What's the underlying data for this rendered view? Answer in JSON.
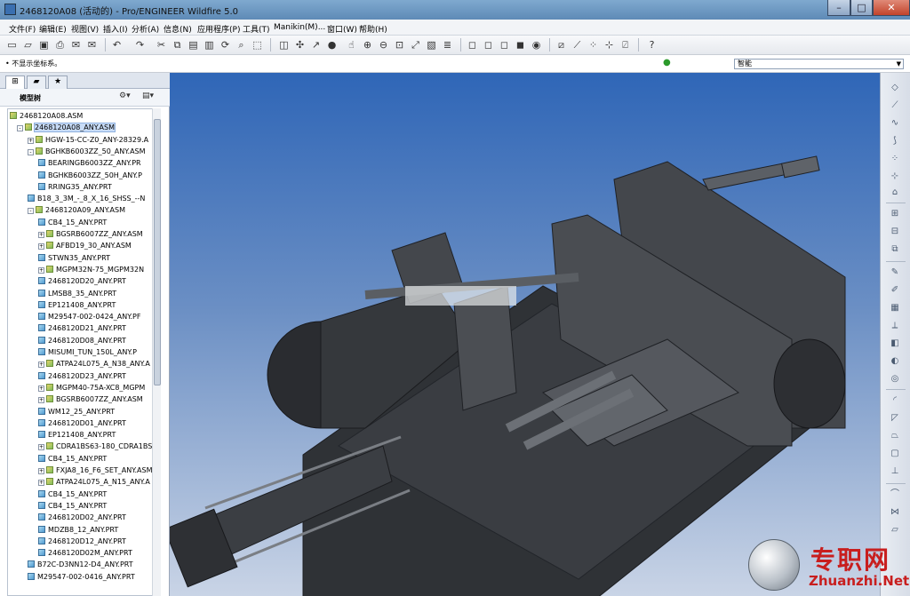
{
  "window": {
    "title": "2468120A08 (活动的) - Pro/ENGINEER Wildfire 5.0",
    "minimize": "–",
    "maximize": "□",
    "close": "✕"
  },
  "menu": [
    "文件(F)",
    "编辑(E)",
    "视图(V)",
    "插入(I)",
    "分析(A)",
    "信息(N)",
    "应用程序(P)",
    "工具(T)",
    "Manikin(M)...",
    "窗口(W)",
    "帮助(H)"
  ],
  "message": "• 不显示坐标系。",
  "filter": {
    "value": "智能"
  },
  "panel": {
    "tree_header": "模型树"
  },
  "tree": [
    {
      "label": "2468120A08.ASM",
      "type": "asm",
      "exp": ""
    },
    {
      "label": "2468120A08_ANY.ASM",
      "type": "asm",
      "exp": "-",
      "selected": true
    },
    {
      "label": "HGW-15-CC-Z0_ANY-28329.A",
      "type": "asm",
      "exp": "+"
    },
    {
      "label": "BGHKB6003ZZ_50_ANY.ASM",
      "type": "asm",
      "exp": "-"
    },
    {
      "label": "BEARINGB6003ZZ_ANY.PR",
      "type": "prt",
      "exp": ""
    },
    {
      "label": "BGHKB6003ZZ_50H_ANY.P",
      "type": "prt",
      "exp": ""
    },
    {
      "label": "RRING35_ANY.PRT",
      "type": "prt",
      "exp": ""
    },
    {
      "label": "B18_3_3M_-_8_X_16_SHSS_--N",
      "type": "prt",
      "exp": ""
    },
    {
      "label": "2468120A09_ANY.ASM",
      "type": "asm",
      "exp": "-"
    },
    {
      "label": "CB4_15_ANY.PRT",
      "type": "prt",
      "exp": ""
    },
    {
      "label": "BGSRB6007ZZ_ANY.ASM",
      "type": "asm",
      "exp": "+"
    },
    {
      "label": "AFBD19_30_ANY.ASM",
      "type": "asm",
      "exp": "+"
    },
    {
      "label": "STWN35_ANY.PRT",
      "type": "prt",
      "exp": ""
    },
    {
      "label": "MGPM32N-75_MGPM32N",
      "type": "asm",
      "exp": "+"
    },
    {
      "label": "2468120D20_ANY.PRT",
      "type": "prt",
      "exp": ""
    },
    {
      "label": "LMSB8_35_ANY.PRT",
      "type": "prt",
      "exp": ""
    },
    {
      "label": "EP121408_ANY.PRT",
      "type": "prt",
      "exp": ""
    },
    {
      "label": "M29547-002-0424_ANY.PF",
      "type": "prt",
      "exp": ""
    },
    {
      "label": "2468120D21_ANY.PRT",
      "type": "prt",
      "exp": ""
    },
    {
      "label": "2468120D08_ANY.PRT",
      "type": "prt",
      "exp": ""
    },
    {
      "label": "MISUMI_TUN_150L_ANY.P",
      "type": "prt",
      "exp": ""
    },
    {
      "label": "ATPA24L075_A_N38_ANY.A",
      "type": "asm",
      "exp": "+"
    },
    {
      "label": "2468120D23_ANY.PRT",
      "type": "prt",
      "exp": ""
    },
    {
      "label": "MGPM40-75A-XC8_MGPM",
      "type": "asm",
      "exp": "+"
    },
    {
      "label": "BGSRB6007ZZ_ANY.ASM",
      "type": "asm",
      "exp": "+"
    },
    {
      "label": "WM12_25_ANY.PRT",
      "type": "prt",
      "exp": ""
    },
    {
      "label": "2468120D01_ANY.PRT",
      "type": "prt",
      "exp": ""
    },
    {
      "label": "EP121408_ANY.PRT",
      "type": "prt",
      "exp": ""
    },
    {
      "label": "CDRA1BS63-180_CDRA1BS",
      "type": "asm",
      "exp": "+"
    },
    {
      "label": "CB4_15_ANY.PRT",
      "type": "prt",
      "exp": ""
    },
    {
      "label": "FXJA8_16_F6_SET_ANY.ASM",
      "type": "asm",
      "exp": "+"
    },
    {
      "label": "ATPA24L075_A_N15_ANY.A",
      "type": "asm",
      "exp": "+"
    },
    {
      "label": "CB4_15_ANY.PRT",
      "type": "prt",
      "exp": ""
    },
    {
      "label": "CB4_15_ANY.PRT",
      "type": "prt",
      "exp": ""
    },
    {
      "label": "2468120D02_ANY.PRT",
      "type": "prt",
      "exp": ""
    },
    {
      "label": "MDZB8_12_ANY.PRT",
      "type": "prt",
      "exp": ""
    },
    {
      "label": "2468120D12_ANY.PRT",
      "type": "prt",
      "exp": ""
    },
    {
      "label": "2468120D02M_ANY.PRT",
      "type": "prt",
      "exp": ""
    },
    {
      "label": "B72C-D3NN12-D4_ANY.PRT",
      "type": "prt",
      "exp": ""
    },
    {
      "label": "M29547-002-0416_ANY.PRT",
      "type": "prt",
      "exp": ""
    }
  ],
  "watermark": {
    "cn": "专职网",
    "en": "Zhuanzhi.Net"
  },
  "colors": {
    "viewport_top": "#2f66b7",
    "viewport_bottom": "#c9d4e6",
    "model": "#3a3d42",
    "selection": "#c8dcf7"
  }
}
